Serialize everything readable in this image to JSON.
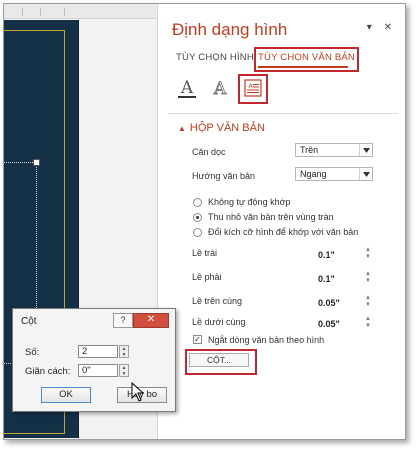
{
  "pane": {
    "title": "Định dạng hình",
    "controls": {
      "dropdown": "▾",
      "close": "✕"
    },
    "tabs": [
      {
        "label": "TÙY CHỌN HÌNH"
      },
      {
        "label": "TÙY CHỌN VĂN BẢN"
      }
    ],
    "icons": [
      "text-fill-outline-icon",
      "text-effects-icon",
      "textbox-icon"
    ],
    "section": {
      "toggle": "▲",
      "title": "HỘP VĂN BẢN"
    },
    "vertical_align": {
      "label": "Căn dọc",
      "value": "Trên"
    },
    "text_direction": {
      "label": "Hướng văn bản",
      "value": "Ngang"
    },
    "autofit_options": [
      {
        "label": "Không tự động khớp",
        "selected": false
      },
      {
        "label": "Thu nhỏ văn bản trên vùng tràn",
        "selected": true
      },
      {
        "label": "Đổi kích cỡ hình để khớp với văn bản",
        "selected": false
      }
    ],
    "margins": [
      {
        "label": "Lề trái",
        "value": "0.1\""
      },
      {
        "label": "Lề phải",
        "value": "0.1\""
      },
      {
        "label": "Lề trên cùng",
        "value": "0.05\""
      },
      {
        "label": "Lề dưới cùng",
        "value": "0.05\""
      }
    ],
    "wrap_text": {
      "label": "Ngắt dòng văn bản theo hình",
      "checked": true
    },
    "columns_button": "CỘT..."
  },
  "dialog": {
    "title": "Cột",
    "help": "?",
    "close": "✕",
    "number_label": "Số:",
    "number_value": "2",
    "spacing_label": "Giãn cách:",
    "spacing_value": "0\"",
    "ok": "OK",
    "cancel": "Hủy bo"
  },
  "colors": {
    "accent": "#c43b1d",
    "highlight": "#c1272d",
    "slide_bg": "#143047",
    "slide_border": "#c5a636"
  }
}
